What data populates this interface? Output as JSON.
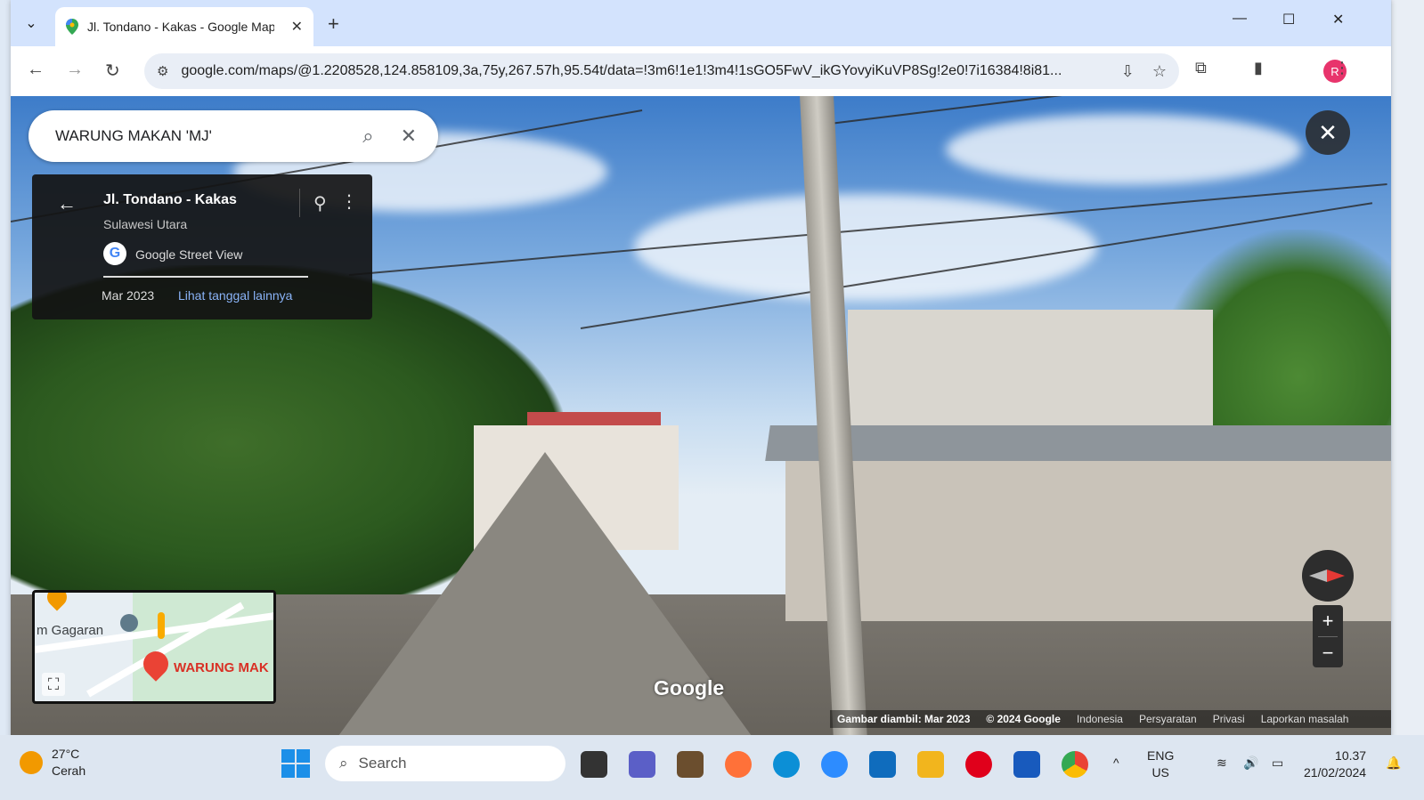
{
  "browser": {
    "tab_title": "Jl. Tondano - Kakas - Google Maps",
    "url": "google.com/maps/@1.2208528,124.858109,3a,75y,267.57h,95.54t/data=!3m6!1e1!3m4!1sGO5FwV_ikGYovyiKuVP8Sg!2e0!7i16384!8i81...",
    "avatar_letter": "R",
    "new_tab_label": "+",
    "minimize": "—",
    "maximize": "☐",
    "close": "✕"
  },
  "search": {
    "query": "WARUNG MAKAN 'MJ'"
  },
  "card": {
    "title": "Jl. Tondano - Kakas",
    "region": "Sulawesi Utara",
    "source": "Google Street View",
    "date": "Mar 2023",
    "more_dates_link": "Lihat tanggal lainnya"
  },
  "minimap": {
    "label_place": "m Gagaran",
    "label_pin": "WARUNG MAK"
  },
  "streetview": {
    "watermark": "Google",
    "footer": {
      "image_date": "Gambar diambil: Mar 2023",
      "copyright": "© 2024 Google",
      "country": "Indonesia",
      "terms": "Persyaratan",
      "privacy": "Privasi",
      "report": "Laporkan masalah"
    },
    "zoom_in": "+",
    "zoom_out": "−"
  },
  "taskbar": {
    "temperature": "27°C",
    "weather": "Cerah",
    "search_label": "Search",
    "lang_top": "ENG",
    "lang_bottom": "US",
    "time": "10.37",
    "date": "21/02/2024"
  },
  "colors": {
    "tabbar": "#d3e3fd",
    "link": "#8ab4f8",
    "pin_red": "#ea4335"
  }
}
